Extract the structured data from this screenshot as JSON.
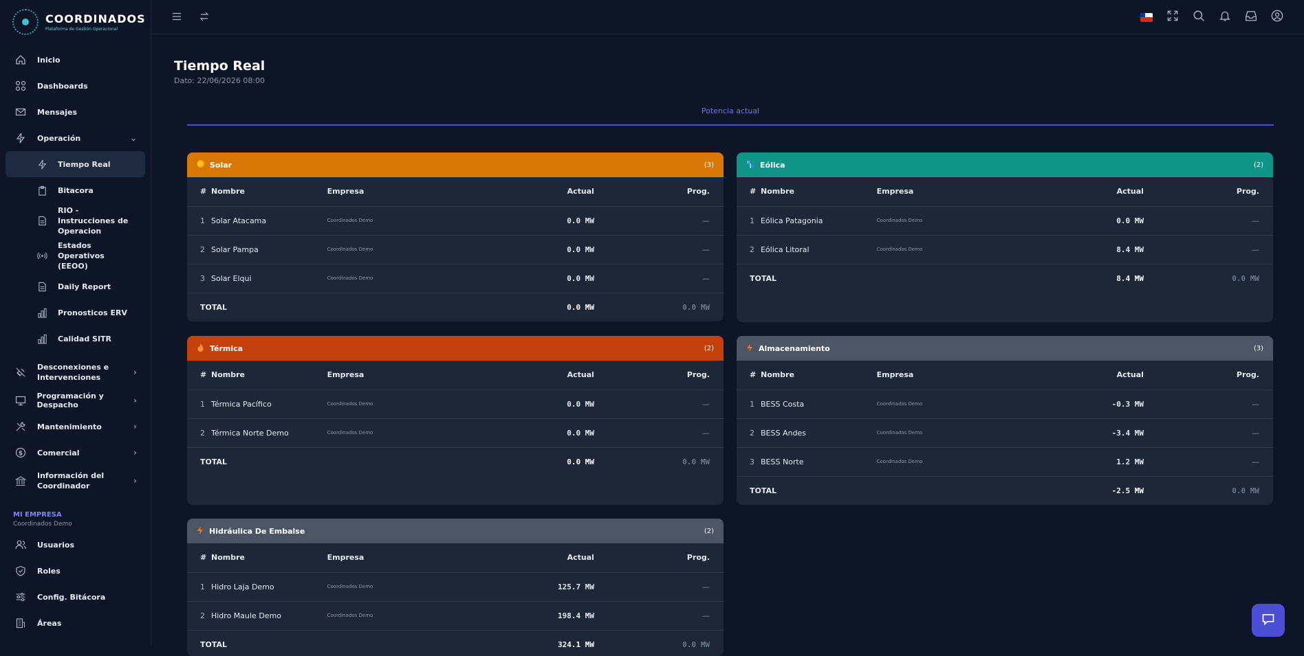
{
  "brand": {
    "name": "COORDINADOS",
    "subtitle": "Plataforma de Gestión Operacional"
  },
  "sidebar": {
    "items": [
      {
        "label": "Inicio"
      },
      {
        "label": "Dashboards"
      },
      {
        "label": "Mensajes"
      },
      {
        "label": "Operación"
      }
    ],
    "operacion_sub": [
      {
        "label": "Tiempo Real"
      },
      {
        "label": "Bitacora"
      },
      {
        "label": "RIO - Instrucciones de Operacion"
      },
      {
        "label": "Estados Operativos (EEOO)"
      },
      {
        "label": "Daily Report"
      },
      {
        "label": "Pronosticos ERV"
      },
      {
        "label": "Calidad SITR"
      }
    ],
    "groups": [
      {
        "label": "Desconexiones e Intervenciones"
      },
      {
        "label": "Programación y Despacho"
      },
      {
        "label": "Mantenimiento"
      },
      {
        "label": "Comercial"
      },
      {
        "label": "Información del Coordinador"
      }
    ],
    "company_section": {
      "label": "MI EMPRESA",
      "name": "Coordinados Demo"
    },
    "admin": [
      {
        "label": "Usuarios"
      },
      {
        "label": "Roles"
      },
      {
        "label": "Config. Bitácora"
      },
      {
        "label": "Áreas"
      }
    ]
  },
  "page": {
    "title": "Tiempo Real",
    "date": "Dato: 22/06/2026 08:00",
    "tab": "Potencia actual"
  },
  "columns": {
    "idx": "#",
    "name": "Nombre",
    "company": "Empresa",
    "actual": "Actual",
    "prog": "Prog."
  },
  "cards": {
    "solar": {
      "title": "Solar",
      "count": "(3)",
      "color": "#d97706",
      "rows": [
        {
          "i": "1",
          "name": "Solar Atacama",
          "company": "Coordinados Demo",
          "actual": "0.0 MW",
          "prog": "—"
        },
        {
          "i": "2",
          "name": "Solar Pampa",
          "company": "Coordinados Demo",
          "actual": "0.0 MW",
          "prog": "—"
        },
        {
          "i": "3",
          "name": "Solar Elqui",
          "company": "Coordinados Demo",
          "actual": "0.0 MW",
          "prog": "—"
        }
      ],
      "total_label": "TOTAL",
      "total_actual": "0.0 MW",
      "total_prog": "0.0 MW"
    },
    "eolica": {
      "title": "Eólica",
      "count": "(2)",
      "color": "#0f9488",
      "rows": [
        {
          "i": "1",
          "name": "Eólica Patagonia",
          "company": "Coordinados Demo",
          "actual": "0.0 MW",
          "prog": "—"
        },
        {
          "i": "2",
          "name": "Eólica Litoral",
          "company": "Coordinados Demo",
          "actual": "8.4 MW",
          "prog": "—"
        }
      ],
      "total_label": "TOTAL",
      "total_actual": "8.4 MW",
      "total_prog": "0.0 MW"
    },
    "termica": {
      "title": "Térmica",
      "count": "(2)",
      "color": "#c2410c",
      "rows": [
        {
          "i": "1",
          "name": "Térmica Pacífico",
          "company": "Coordinados Demo",
          "actual": "0.0 MW",
          "prog": "—"
        },
        {
          "i": "2",
          "name": "Térmica Norte Demo",
          "company": "Coordinados Demo",
          "actual": "0.0 MW",
          "prog": "—"
        }
      ],
      "total_label": "TOTAL",
      "total_actual": "0.0 MW",
      "total_prog": "0.0 MW"
    },
    "almacenamiento": {
      "title": "Almacenamiento",
      "count": "(3)",
      "color": "#4b5563",
      "rows": [
        {
          "i": "1",
          "name": "BESS Costa",
          "company": "Coordinados Demo",
          "actual": "-0.3 MW",
          "prog": "—"
        },
        {
          "i": "2",
          "name": "BESS Andes",
          "company": "Coordinados Demo",
          "actual": "-3.4 MW",
          "prog": "—"
        },
        {
          "i": "3",
          "name": "BESS Norte",
          "company": "Coordinados Demo",
          "actual": "1.2 MW",
          "prog": "—"
        }
      ],
      "total_label": "TOTAL",
      "total_actual": "-2.5 MW",
      "total_prog": "0.0 MW"
    },
    "hidraulica": {
      "title": "Hidráulica De Embalse",
      "count": "(2)",
      "color": "#4b5563",
      "rows": [
        {
          "i": "1",
          "name": "Hidro Laja Demo",
          "company": "Coordinados Demo",
          "actual": "125.7 MW",
          "prog": "—"
        },
        {
          "i": "2",
          "name": "Hidro Maule Demo",
          "company": "Coordinados Demo",
          "actual": "198.4 MW",
          "prog": "—"
        }
      ],
      "total_label": "TOTAL",
      "total_actual": "324.1 MW",
      "total_prog": "0.0 MW"
    }
  }
}
